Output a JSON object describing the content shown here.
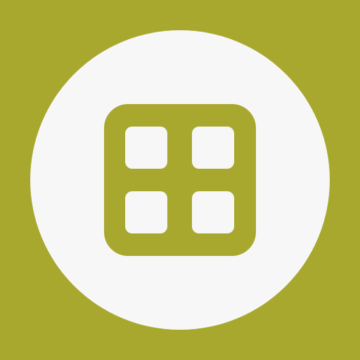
{
  "app_icon": {
    "icon_name": "grid-icon",
    "colors": {
      "background": "#a8a82e",
      "circle": "#f7f7f7",
      "glyph": "#a8a82e",
      "glyph_cells": "#f7f7f7"
    }
  }
}
